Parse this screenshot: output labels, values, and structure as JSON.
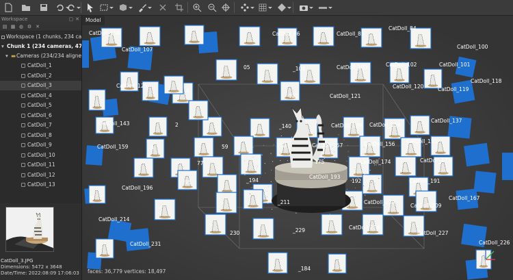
{
  "workspace": {
    "title": "Workspace",
    "root": "Workspace (1 chunks, 234 came",
    "chunk": "Chunk 1 (234 cameras, 47,1",
    "cameras_folder": "Cameras (234/234 aligne",
    "cameras": [
      "CatDoll_1",
      "CatDoll_2",
      "CatDoll_3",
      "CatDoll_4",
      "CatDoll_5",
      "CatDoll_6",
      "CatDoll_7",
      "CatDoll_8",
      "CatDoll_9",
      "CatDoll_10",
      "CatDoll_11",
      "CatDoll_12",
      "CatDoll_13"
    ],
    "selected_index": 2
  },
  "preview": {
    "filename": "CatDoll_3.JPG",
    "dimensions": "Dimensions: 5472 x 3648",
    "datetime": "Date/Time: 2022:08:09 17:06:03"
  },
  "model": {
    "tab": "Model",
    "stats": "faces: 36,779 vertices: 18,497",
    "labels": [
      {
        "t": "CatDoll_86"
      },
      {
        "t": "CatDoll_85"
      },
      {
        "t": "CatDoll_84"
      },
      {
        "t": "CatDoll_107"
      },
      {
        "t": "CatDoll_100"
      },
      {
        "t": "05"
      },
      {
        "t": "_104"
      },
      {
        "t": "CatDoll_103"
      },
      {
        "t": "CatDoll_102"
      },
      {
        "t": "CatDoll_101"
      },
      {
        "t": "CatDoll_125"
      },
      {
        "t": "CatDoll_118"
      },
      {
        "t": "4"
      },
      {
        "t": "122"
      },
      {
        "t": "CatDoll_121"
      },
      {
        "t": "CatDoll_120"
      },
      {
        "t": "CatDoll_119"
      },
      {
        "t": "CatDoll_143"
      },
      {
        "t": "2"
      },
      {
        "t": "_140"
      },
      {
        "t": "CatDoll_139"
      },
      {
        "t": "CatDoll_138"
      },
      {
        "t": "CatDoll_137"
      },
      {
        "t": "CatDoll_159"
      },
      {
        "t": "158"
      },
      {
        "t": "CatDoll_157"
      },
      {
        "t": "CatDoll_156"
      },
      {
        "t": "CatDoll_155"
      },
      {
        "t": "0"
      },
      {
        "t": "59"
      },
      {
        "t": "77"
      },
      {
        "t": "175"
      },
      {
        "t": "CatDoll_174"
      },
      {
        "t": "CatDoll_173"
      },
      {
        "t": "95"
      },
      {
        "t": "_194"
      },
      {
        "t": "CatDoll_193"
      },
      {
        "t": "192"
      },
      {
        "t": "CatDoll_191"
      },
      {
        "t": "CatDoll_196"
      },
      {
        "t": "5"
      },
      {
        "t": "_211"
      },
      {
        "t": "CatDoll_210"
      },
      {
        "t": "CatDoll_209"
      },
      {
        "t": "CatDoll_167"
      },
      {
        "t": "CatDoll_214"
      },
      {
        "t": "_229"
      },
      {
        "t": "CatDoll_228"
      },
      {
        "t": "CatDoll_227"
      },
      {
        "t": "CatDoll_231"
      },
      {
        "t": "230"
      },
      {
        "t": "CatDoll_226"
      },
      {
        "t": "_184"
      },
      {
        "t": "CatDoll_108"
      }
    ]
  },
  "icons": [
    "new-file-icon",
    "open-folder-icon",
    "save-icon",
    "pointer-icon",
    "rect-select-icon",
    "box-icon",
    "brush-icon",
    "close-icon",
    "crop-icon",
    "zoom-in-icon",
    "zoom-out-icon",
    "move-icon",
    "rotate-icon",
    "grid-icon",
    "shading-icon",
    "camera-icon",
    "ruler-icon"
  ],
  "colors": {
    "accent_blue": "#1f6fcf",
    "panel": "#2f2f2f",
    "viewport": "#3a3a3a"
  }
}
